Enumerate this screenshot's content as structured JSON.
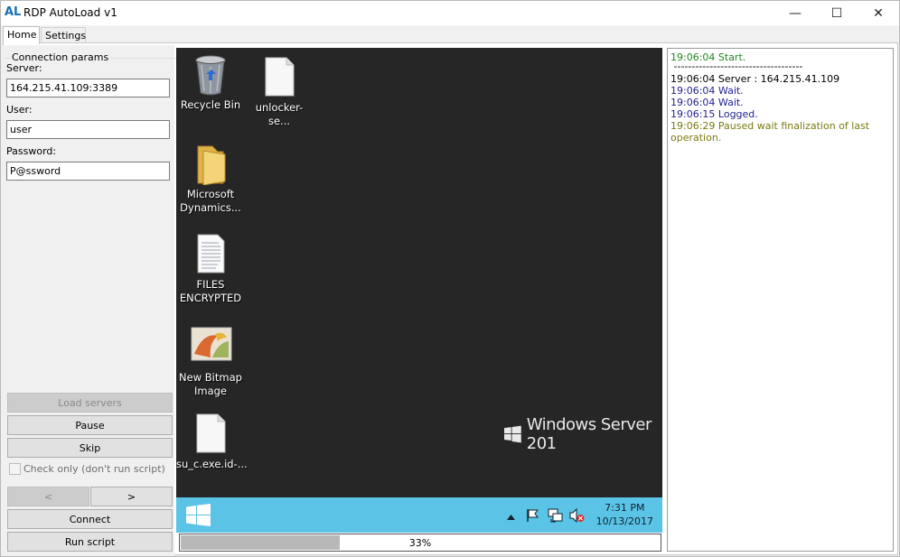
{
  "window": {
    "logo": "AL",
    "title": "RDP AutoLoad v1",
    "minimize_glyph": "—",
    "maximize_glyph": "☐",
    "close_glyph": "✕"
  },
  "tabs": [
    {
      "label": "Home",
      "active": true
    },
    {
      "label": "Settings",
      "active": false
    }
  ],
  "connection": {
    "group_label": "Connection params",
    "server_label": "Server:",
    "server_value": "164.215.41.109:3389",
    "user_label": "User:",
    "user_value": "user",
    "password_label": "Password:",
    "password_value": "P@ssword"
  },
  "buttons": {
    "load_servers": "Load servers",
    "pause": "Pause",
    "skip": "Skip",
    "check_only": "Check only (don't run script)",
    "prev": "<",
    "next": ">",
    "connect": "Connect",
    "run_script": "Run script"
  },
  "remote_desktop": {
    "icons": [
      {
        "label": "Recycle Bin",
        "icon": "recycle-bin-icon"
      },
      {
        "label": "unlocker-se...",
        "icon": "file-icon"
      },
      {
        "label": "Microsoft Dynamics...",
        "icon": "folder-icon"
      },
      {
        "label": "FILES ENCRYPTED",
        "icon": "text-document-icon"
      },
      {
        "label": "New Bitmap Image",
        "icon": "bitmap-image-icon"
      },
      {
        "label": "su_c.exe.id-...",
        "icon": "file-icon"
      }
    ],
    "os_brand": "Windows Server 201",
    "clock_time": "7:31 PM",
    "clock_date": "10/13/2017",
    "taskbar_color": "#5ac3e6",
    "desktop_color": "#262626"
  },
  "progress": {
    "value": 0.33,
    "label": "33%"
  },
  "log": [
    {
      "text": "19:06:04 Start.",
      "color": "#1e8a1e"
    },
    {
      "text": " ------------------------------------",
      "color": "#000000"
    },
    {
      "text": "19:06:04 Server : 164.215.41.109",
      "color": "#000000"
    },
    {
      "text": "19:06:04 Wait.",
      "color": "#1f1f8f"
    },
    {
      "text": "19:06:04 Wait.",
      "color": "#1f1f8f"
    },
    {
      "text": "19:06:15 Logged.",
      "color": "#1f1f8f"
    },
    {
      "text": "19:06:29 Paused wait finalization of last operation.",
      "color": "#7a7a10"
    }
  ]
}
